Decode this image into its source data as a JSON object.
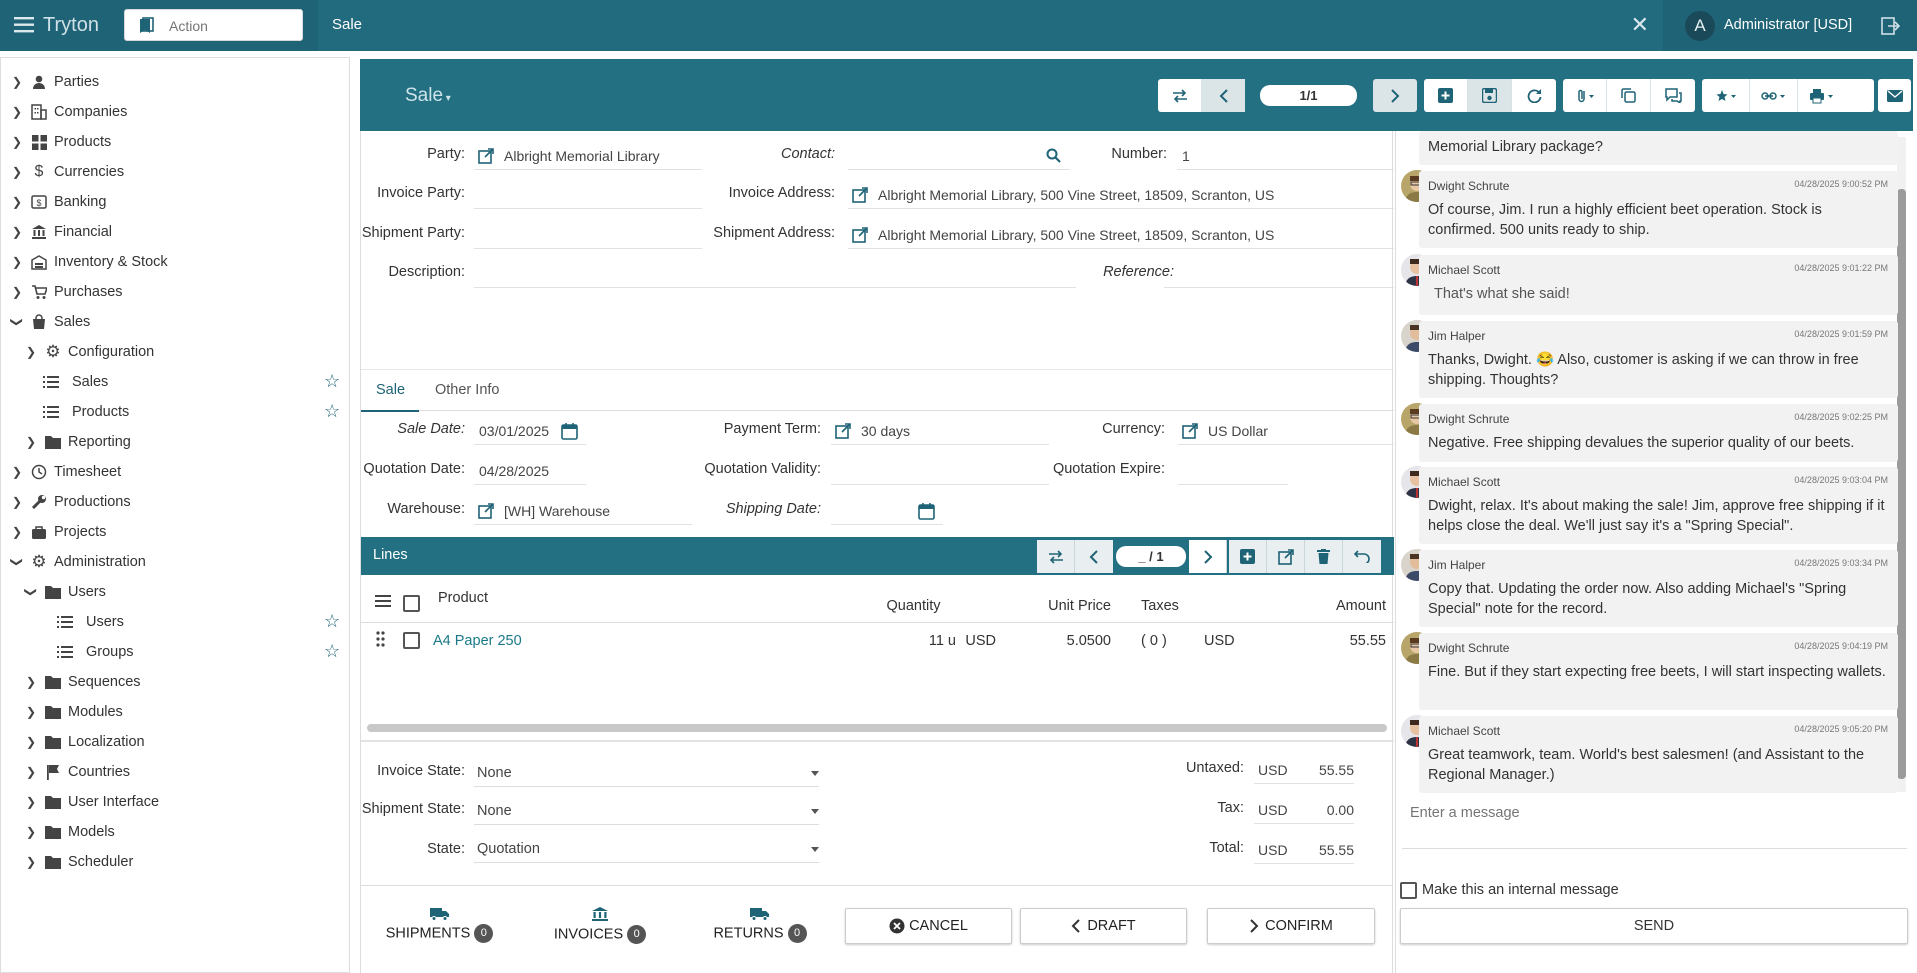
{
  "app": {
    "brand": "Tryton",
    "action_placeholder": "Action",
    "tab_title": "Sale",
    "user": "Administrator [USD]",
    "user_initial": "A",
    "accent": "#1f6376",
    "link": "#1a7a8a"
  },
  "sidebar": {
    "items": [
      {
        "label": "Parties"
      },
      {
        "label": "Companies"
      },
      {
        "label": "Products"
      },
      {
        "label": "Currencies"
      },
      {
        "label": "Banking"
      },
      {
        "label": "Financial"
      },
      {
        "label": "Inventory & Stock"
      },
      {
        "label": "Purchases"
      },
      {
        "label": "Sales"
      },
      {
        "label": "Configuration"
      },
      {
        "label": "Sales"
      },
      {
        "label": "Products"
      },
      {
        "label": "Reporting"
      },
      {
        "label": "Timesheet"
      },
      {
        "label": "Productions"
      },
      {
        "label": "Projects"
      },
      {
        "label": "Administration"
      },
      {
        "label": "Users"
      },
      {
        "label": "Users"
      },
      {
        "label": "Groups"
      },
      {
        "label": "Sequences"
      },
      {
        "label": "Modules"
      },
      {
        "label": "Localization"
      },
      {
        "label": "Countries"
      },
      {
        "label": "User Interface"
      },
      {
        "label": "Models"
      },
      {
        "label": "Scheduler"
      }
    ]
  },
  "form": {
    "title": "Sale",
    "record_pos": "1/1",
    "labels": {
      "party": "Party:",
      "contact": "Contact:",
      "number": "Number:",
      "invoice_party": "Invoice Party:",
      "invoice_address": "Invoice Address:",
      "shipment_party": "Shipment Party:",
      "shipment_address": "Shipment Address:",
      "description": "Description:",
      "reference": "Reference:",
      "sale_date": "Sale Date:",
      "payment_term": "Payment Term:",
      "currency": "Currency:",
      "quotation_date": "Quotation Date:",
      "quotation_validity": "Quotation Validity:",
      "quotation_expire": "Quotation Expire:",
      "warehouse": "Warehouse:",
      "shipping_date": "Shipping Date:"
    },
    "values": {
      "party": "Albright Memorial Library",
      "number": "1",
      "invoice_address": "Albright Memorial Library, 500 Vine Street, 18509, Scranton, US",
      "shipment_address": "Albright Memorial Library, 500 Vine Street, 18509, Scranton, US",
      "sale_date": "03/01/2025",
      "payment_term": "30 days",
      "currency": "US Dollar",
      "quotation_date": "04/28/2025",
      "warehouse": "[WH] Warehouse"
    },
    "tabs": [
      "Sale",
      "Other Info"
    ],
    "lines": {
      "title": "Lines",
      "pos": "_ / 1",
      "headers": {
        "product": "Product",
        "quantity": "Quantity",
        "unit_price": "Unit Price",
        "taxes": "Taxes",
        "amount": "Amount"
      },
      "rows": [
        {
          "product": "A4 Paper 250",
          "quantity": "11 u",
          "cur1": "USD",
          "unit_price": "5.0500",
          "taxes": "( 0 )",
          "cur2": "USD",
          "amount": "55.55"
        }
      ]
    },
    "states": {
      "invoice_state_label": "Invoice State:",
      "invoice_state": "None",
      "shipment_state_label": "Shipment State:",
      "shipment_state": "None",
      "state_label": "State:",
      "state": "Quotation"
    },
    "totals": {
      "untaxed_label": "Untaxed:",
      "untaxed_cur": "USD",
      "untaxed": "55.55",
      "tax_label": "Tax:",
      "tax_cur": "USD",
      "tax": "0.00",
      "total_label": "Total:",
      "total_cur": "USD",
      "total": "55.55"
    },
    "relations": [
      {
        "label": "SHIPMENTS",
        "count": "0"
      },
      {
        "label": "INVOICES",
        "count": "0"
      },
      {
        "label": "RETURNS",
        "count": "0"
      }
    ],
    "buttons": {
      "cancel": "CANCEL",
      "draft": "DRAFT",
      "confirm": "CONFIRM"
    }
  },
  "chat": {
    "first_partial": "Memorial Library package?",
    "messages": [
      {
        "author": "Dwight Schrute",
        "time": "04/28/2025 9:00:52 PM",
        "text": "Of course, Jim. I run a highly efficient beet operation. Stock is confirmed. 500 units ready to ship."
      },
      {
        "author": "Michael Scott",
        "time": "04/28/2025 9:01:22 PM",
        "text": "That's what she said!"
      },
      {
        "author": "Jim Halper",
        "time": "04/28/2025 9:01:59 PM",
        "text": "Thanks, Dwight. 😂 Also, customer is asking if we can throw in free shipping. Thoughts?"
      },
      {
        "author": "Dwight Schrute",
        "time": "04/28/2025 9:02:25 PM",
        "text": "Negative. Free shipping devalues the superior quality of our beets."
      },
      {
        "author": "Michael Scott",
        "time": "04/28/2025 9:03:04 PM",
        "text": "Dwight, relax. It's about making the sale! Jim, approve free shipping if it helps close the deal. We'll just say it's a \"Spring Special\"."
      },
      {
        "author": "Jim Halper",
        "time": "04/28/2025 9:03:34 PM",
        "text": "Copy that. Updating the order now. Also adding Michael's \"Spring Special\" note for the record."
      },
      {
        "author": "Dwight Schrute",
        "time": "04/28/2025 9:04:19 PM",
        "text": "Fine. But if they start expecting free beets, I will start inspecting wallets."
      },
      {
        "author": "Michael Scott",
        "time": "04/28/2025 9:05:20 PM",
        "text": "Great teamwork, team. World's best salesmen! (and Assistant to the Regional Manager.)"
      }
    ],
    "placeholder": "Enter a message",
    "internal_label": "Make this an internal message",
    "send": "SEND"
  }
}
